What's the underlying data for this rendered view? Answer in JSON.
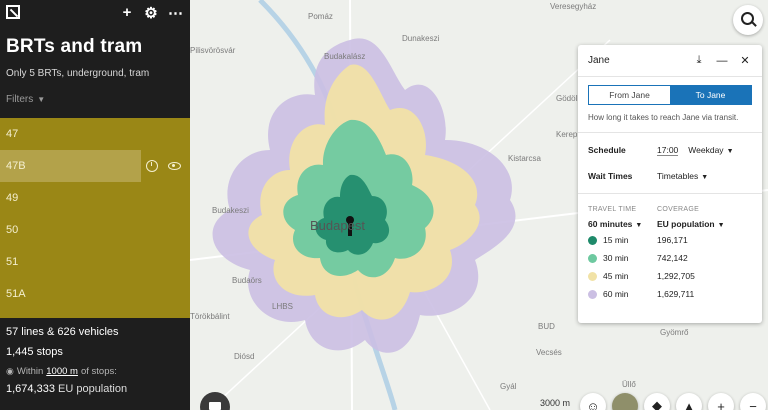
{
  "sidebar": {
    "title": "BRTs and tram",
    "subtitle": "Only 5 BRTs, underground, tram",
    "filters_label": "Filters",
    "routes": [
      "47",
      "47B",
      "49",
      "50",
      "51",
      "51A"
    ],
    "active_route": "47B",
    "stats": {
      "lines": "57 lines",
      "amp": "&",
      "vehicles": "626 vehicles",
      "stops": "1,445 stops",
      "within_prefix": "Within",
      "within_distance": "1000 m",
      "within_suffix": "of stops:",
      "population_value": "1,674,333",
      "population_label": "EU population"
    }
  },
  "map": {
    "labels": {
      "pomaz": "Pomáz",
      "veresegyhaz": "Veresegyház",
      "dunakeszi": "Dunakeszi",
      "pilisvorosvar": "Pilisvörösvár",
      "budakalasz": "Budakalász",
      "godollo": "Gödöllő",
      "kerep": "Kerep",
      "kistarcsa": "Kistarcsa",
      "budakeszi": "Budakeszi",
      "budapest": "Budapest",
      "budaors": "Budaörs",
      "lhbs": "LHBS",
      "torokbalint": "Törökbálint",
      "bud": "BUD",
      "gyomro": "Gyömrő",
      "diosd": "Diósd",
      "vecses": "Vecsés",
      "gyal": "Gyál",
      "ullo": "Üllő"
    },
    "scale": "3000 m",
    "colors": {
      "m15": "#1e8a6a",
      "m30": "#6ec9a0",
      "m45": "#f1e2a6",
      "m60": "#cbbfe3"
    }
  },
  "panel": {
    "title": "Jane",
    "from_label": "From Jane",
    "to_label": "To Jane",
    "description": "How long it takes to reach Jane via transit.",
    "schedule_label": "Schedule",
    "schedule_time": "17:00",
    "schedule_day": "Weekday",
    "wait_label": "Wait Times",
    "wait_value": "Timetables",
    "travel_time_header": "TRAVEL TIME",
    "coverage_header": "COVERAGE",
    "travel_time_selected": "60 minutes",
    "coverage_selected": "EU population",
    "rows": [
      {
        "time": "15 min",
        "value": "196,171",
        "color": "#1e8a6a"
      },
      {
        "time": "30 min",
        "value": "742,142",
        "color": "#6ec9a0"
      },
      {
        "time": "45 min",
        "value": "1,292,705",
        "color": "#f1e2a6"
      },
      {
        "time": "60 min",
        "value": "1,629,711",
        "color": "#cbbfe3"
      }
    ]
  }
}
